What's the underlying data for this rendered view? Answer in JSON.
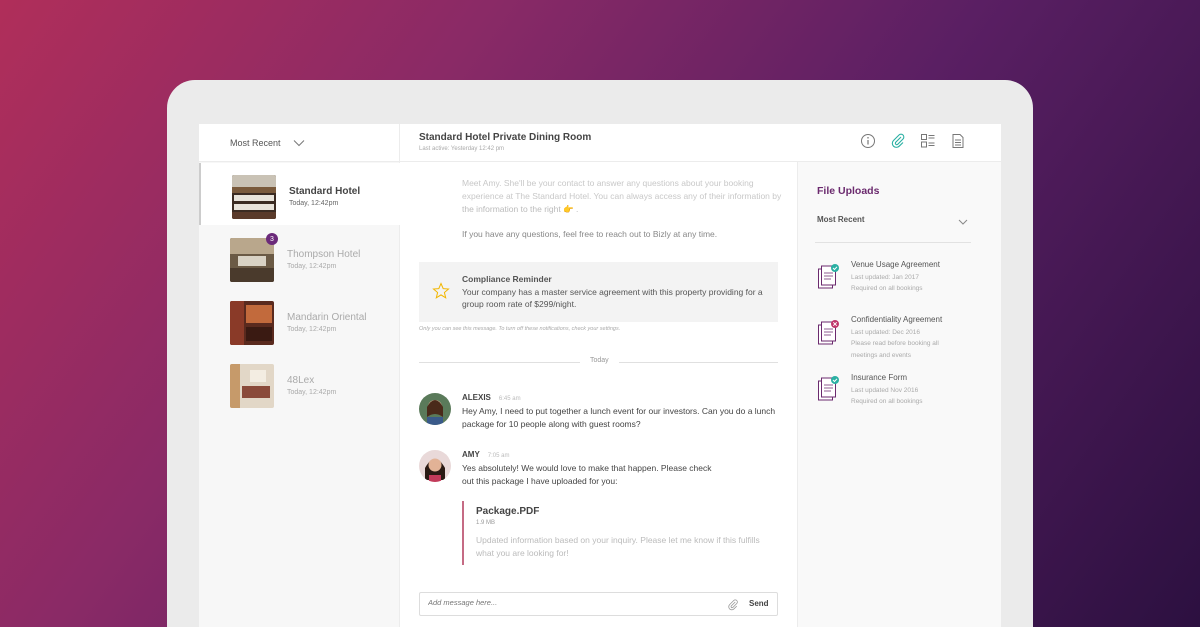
{
  "sidebar": {
    "sort_label": "Most Recent",
    "items": [
      {
        "name": "Standard Hotel",
        "time": "Today, 12:42pm",
        "badge": ""
      },
      {
        "name": "Thompson Hotel",
        "time": "Today, 12:42pm",
        "badge": "3"
      },
      {
        "name": "Mandarin Oriental",
        "time": "Today, 12:42pm",
        "badge": ""
      },
      {
        "name": "48Lex",
        "time": "Today, 12:42pm",
        "badge": ""
      }
    ]
  },
  "conversation": {
    "title": "Standard Hotel Private Dining Room",
    "last_active": "Last active: Yesterday 12:42 pm",
    "intro_line1": "Meet Amy. She'll be your contact to answer any questions about your booking",
    "intro_line2": "experience at The Standard Hotel. You can always access any of their information by",
    "intro_line3": "the information to the right 👉 .",
    "intro_line4": "If you have any questions, feel free to reach out to Bizly at any time.",
    "compliance_title": "Compliance Reminder",
    "compliance_body": "Your company has a master service agreement with this property providing for a group room rate of $299/night.",
    "only_you": "Only you can see this message.  To turn off these notifications, check your settings.",
    "day_divider": "Today",
    "messages": [
      {
        "sender": "ALEXIS",
        "time": "6:45 am",
        "line1": "Hey Amy, I need to put together a lunch event for our investors. Can you do a lunch",
        "line2": "package for 10 people along with guest rooms?"
      },
      {
        "sender": "AMY",
        "time": "7:05 am",
        "line1": "Yes absolutely! We would love to make that happen. Please check",
        "line2": "out this package I have uploaded for you:"
      }
    ],
    "attachment": {
      "name": "Package.PDF",
      "size": "1.9 MB",
      "desc": "Updated information based on your inquiry. Please let me know if this fulfills what you are looking for!"
    },
    "composer_placeholder": "Add message here...",
    "send_label": "Send"
  },
  "files": {
    "title": "File Uploads",
    "sort_label": "Most Recent",
    "docs": [
      {
        "title": "Venue Usage Agreement",
        "sub1": "Last updated: Jan 2017",
        "sub2": "Required on all bookings",
        "status": "ok"
      },
      {
        "title": "Confidentiality Agreement",
        "sub1": "Last updated: Dec 2016",
        "sub2": "Please read before booking all meetings and events",
        "status": "error"
      },
      {
        "title": "Insurance Form",
        "sub1": "Last updated Nov 2016",
        "sub2": "Required on all bookings",
        "status": "ok"
      }
    ]
  },
  "colors": {
    "accent": "#6b2a6e",
    "ok": "#2bb0a3",
    "error": "#c0356b",
    "star": "#f2b600"
  },
  "icons": [
    "chevron-down-icon",
    "info-icon",
    "paperclip-icon",
    "layout-icon",
    "document-icon",
    "star-icon",
    "doc-check-icon",
    "doc-error-icon"
  ]
}
